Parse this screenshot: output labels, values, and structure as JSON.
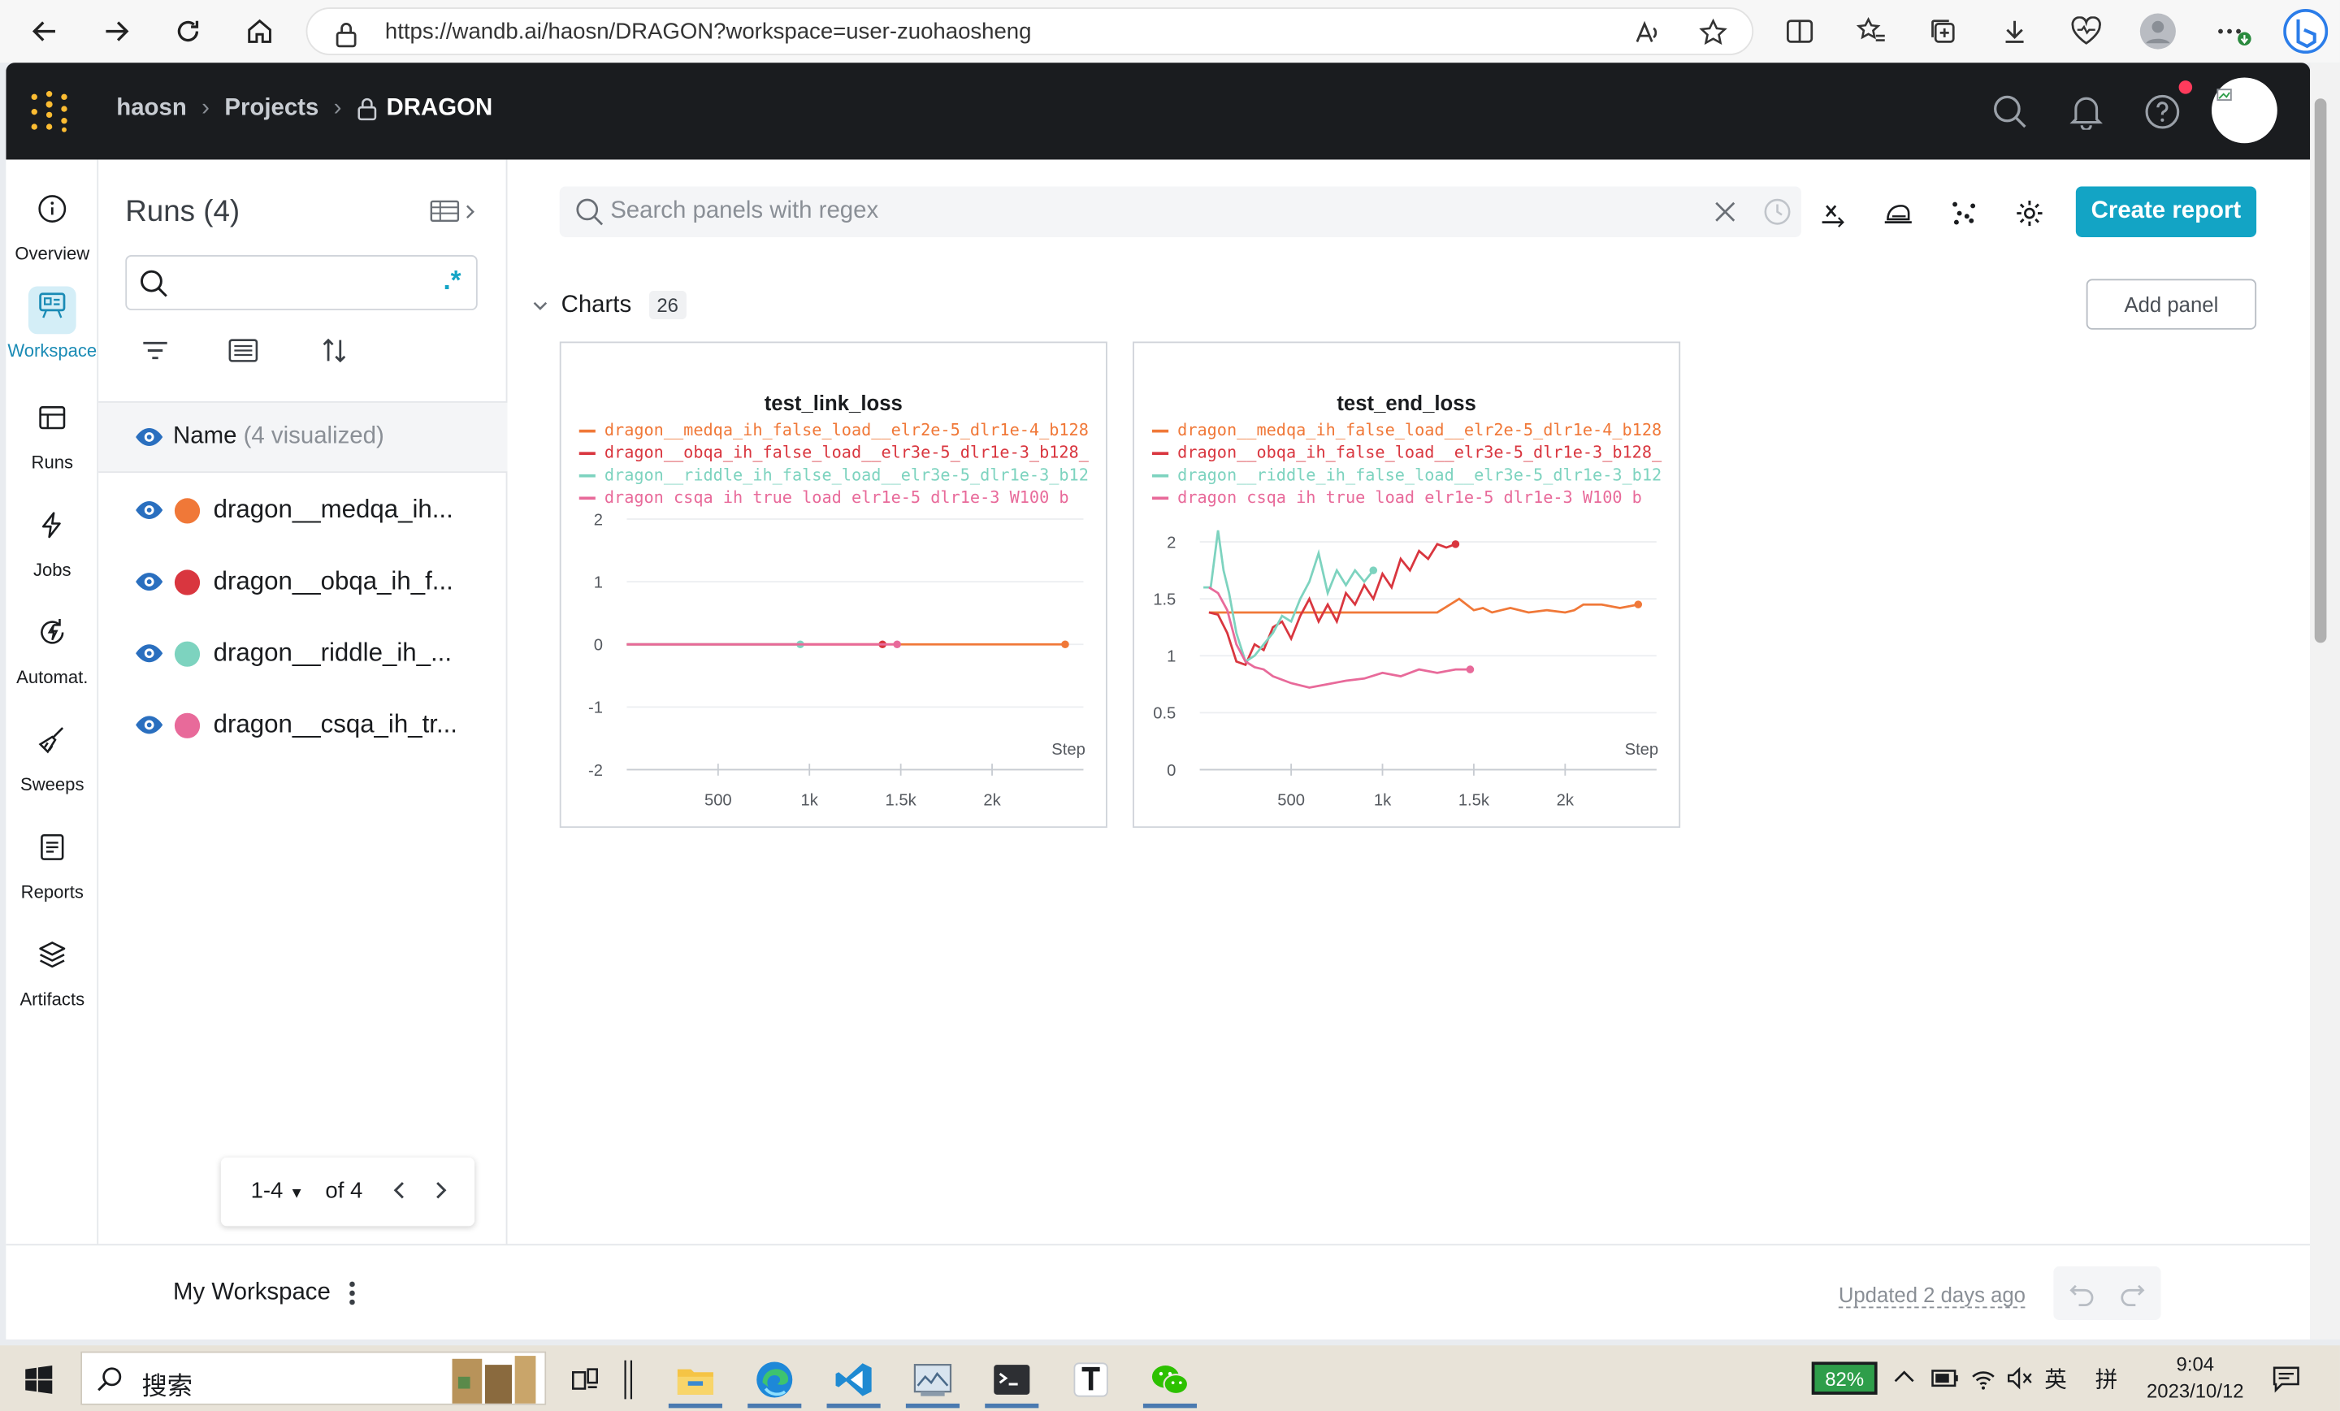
{
  "browser": {
    "url": "https://wandb.ai/haosn/DRAGON?workspace=user-zuohaosheng"
  },
  "topnav": {
    "crumb_user": "haosn",
    "crumb_projects": "Projects",
    "crumb_project": "DRAGON"
  },
  "rail": {
    "overview": "Overview",
    "workspace": "Workspace",
    "runs": "Runs",
    "jobs": "Jobs",
    "automations": "Automat.",
    "sweeps": "Sweeps",
    "reports": "Reports",
    "artifacts": "Artifacts"
  },
  "runs_panel": {
    "title": "Runs (4)",
    "regex_label": ".*",
    "name_header": "Name",
    "name_visualized": "(4 visualized)",
    "runs": [
      {
        "name": "dragon__medqa_ih...",
        "color": "#f07838"
      },
      {
        "name": "dragon__obqa_ih_f...",
        "color": "#d9363f"
      },
      {
        "name": "dragon__riddle_ih_...",
        "color": "#7dd3bf"
      },
      {
        "name": "dragon__csqa_ih_tr...",
        "color": "#e86a9a"
      }
    ],
    "pager": {
      "range": "1-4",
      "total": "of 4"
    }
  },
  "main": {
    "search_placeholder": "Search panels with regex",
    "create_report": "Create report",
    "section_title": "Charts",
    "section_count": "26",
    "add_panel": "Add panel"
  },
  "charts": [
    {
      "title": "test_link_loss",
      "legend": [
        {
          "label": "dragon__medqa_ih_false_load__elr2e-5_dlr1e-4_b128",
          "color": "#f07838"
        },
        {
          "label": "dragon__obqa_ih_false_load__elr3e-5_dlr1e-3_b128_",
          "color": "#d9363f"
        },
        {
          "label": "dragon__riddle_ih_false_load__elr3e-5_dlr1e-3_b12",
          "color": "#7dd3bf"
        },
        {
          "label": "dragon  csqa ih true load  elr1e-5 dlr1e-3 W100 b",
          "color": "#e86a9a"
        }
      ],
      "yticks": [
        "2",
        "1",
        "0",
        "-1",
        "-2"
      ],
      "xticks": [
        "500",
        "1k",
        "1.5k",
        "2k"
      ],
      "xlabel": "Step"
    },
    {
      "title": "test_end_loss",
      "legend": [
        {
          "label": "dragon__medqa_ih_false_load__elr2e-5_dlr1e-4_b128",
          "color": "#f07838"
        },
        {
          "label": "dragon__obqa_ih_false_load__elr3e-5_dlr1e-3_b128_",
          "color": "#d9363f"
        },
        {
          "label": "dragon__riddle_ih_false_load__elr3e-5_dlr1e-3_b12",
          "color": "#7dd3bf"
        },
        {
          "label": "dragon  csqa ih true load  elr1e-5 dlr1e-3 W100 b",
          "color": "#e86a9a"
        }
      ],
      "yticks": [
        "2",
        "1.5",
        "1",
        "0.5",
        "0"
      ],
      "xticks": [
        "500",
        "1k",
        "1.5k",
        "2k"
      ],
      "xlabel": "Step"
    }
  ],
  "chart_data": [
    {
      "type": "line",
      "title": "test_link_loss",
      "xlabel": "Step",
      "ylabel": "",
      "xlim": [
        0,
        2500
      ],
      "ylim": [
        -2,
        2
      ],
      "legend": "top",
      "series": [
        {
          "name": "dragon__medqa_ih_false_load__elr2e-5_dlr1e-4_b128",
          "x": [
            0,
            500,
            1000,
            1500,
            2000,
            2400
          ],
          "y": [
            0,
            0,
            0,
            0,
            0,
            0
          ]
        },
        {
          "name": "dragon__obqa_ih_false_load__elr3e-5_dlr1e-3_b128_",
          "x": [
            0,
            500,
            1000,
            1400
          ],
          "y": [
            0,
            0,
            0,
            0
          ]
        },
        {
          "name": "dragon__riddle_ih_false_load__elr3e-5_dlr1e-3_b12",
          "x": [
            0,
            500,
            950
          ],
          "y": [
            0,
            0,
            0
          ]
        },
        {
          "name": "dragon  csqa ih true load  elr1e-5 dlr1e-3 W100 b",
          "x": [
            0,
            500,
            1000,
            1480
          ],
          "y": [
            0,
            0,
            0,
            0
          ]
        }
      ]
    },
    {
      "type": "line",
      "title": "test_end_loss",
      "xlabel": "Step",
      "ylabel": "",
      "xlim": [
        0,
        2500
      ],
      "ylim": [
        0,
        2.2
      ],
      "legend": "top",
      "series": [
        {
          "name": "dragon__medqa_ih_false_load__elr2e-5_dlr1e-4_b128",
          "x": [
            50,
            100,
            150,
            200,
            250,
            300,
            400,
            500,
            700,
            900,
            1100,
            1300,
            1420,
            1500,
            1550,
            1600,
            1700,
            1800,
            1900,
            2000,
            2050,
            2100,
            2200,
            2300,
            2400
          ],
          "y": [
            1.38,
            1.38,
            1.38,
            1.38,
            1.38,
            1.38,
            1.38,
            1.38,
            1.38,
            1.38,
            1.38,
            1.38,
            1.5,
            1.4,
            1.42,
            1.38,
            1.42,
            1.38,
            1.4,
            1.38,
            1.4,
            1.45,
            1.45,
            1.42,
            1.45
          ]
        },
        {
          "name": "dragon__obqa_ih_false_load__elr3e-5_dlr1e-3_b128_",
          "x": [
            50,
            100,
            150,
            200,
            250,
            300,
            350,
            400,
            450,
            500,
            550,
            600,
            650,
            700,
            750,
            800,
            850,
            900,
            950,
            1000,
            1050,
            1100,
            1150,
            1200,
            1250,
            1300,
            1350,
            1400
          ],
          "y": [
            1.38,
            1.36,
            1.2,
            0.95,
            0.92,
            1.1,
            1.05,
            1.25,
            1.3,
            1.15,
            1.35,
            1.5,
            1.3,
            1.45,
            1.3,
            1.55,
            1.45,
            1.62,
            1.5,
            1.72,
            1.6,
            1.85,
            1.75,
            1.92,
            1.85,
            1.98,
            1.95,
            1.98
          ]
        },
        {
          "name": "dragon__riddle_ih_false_load__elr3e-5_dlr1e-3_b12",
          "x": [
            20,
            60,
            100,
            130,
            160,
            200,
            250,
            300,
            350,
            400,
            450,
            500,
            550,
            600,
            650,
            700,
            750,
            800,
            850,
            900,
            950
          ],
          "y": [
            1.6,
            1.6,
            2.1,
            1.75,
            1.55,
            1.2,
            0.95,
            1.0,
            1.1,
            1.2,
            1.35,
            1.3,
            1.5,
            1.65,
            1.9,
            1.55,
            1.75,
            1.62,
            1.75,
            1.65,
            1.75
          ]
        },
        {
          "name": "dragon  csqa ih true load  elr1e-5 dlr1e-3 W100 b",
          "x": [
            50,
            100,
            150,
            200,
            250,
            300,
            350,
            400,
            500,
            600,
            700,
            800,
            900,
            1000,
            1100,
            1200,
            1300,
            1400,
            1480
          ],
          "y": [
            1.6,
            1.55,
            1.4,
            1.1,
            0.95,
            0.9,
            0.88,
            0.82,
            0.76,
            0.72,
            0.75,
            0.78,
            0.8,
            0.85,
            0.82,
            0.88,
            0.85,
            0.88,
            0.88
          ]
        }
      ]
    }
  ],
  "workspace_bar": {
    "name": "My Workspace",
    "updated": "Updated 2 days ago"
  },
  "taskbar": {
    "search_text": "搜索",
    "battery": "82%",
    "ime1": "英",
    "ime2": "拼",
    "time": "9:04",
    "date": "2023/10/12"
  }
}
